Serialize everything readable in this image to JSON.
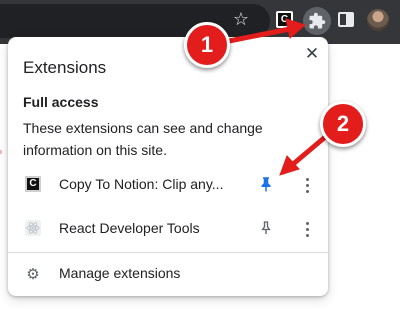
{
  "colors": {
    "toolbar_bg": "#35363a",
    "pin_active": "#1a73e8",
    "pin_inactive": "#5f6368",
    "marker_red": "#e31c1c"
  },
  "toolbar": {
    "icons": [
      "star-icon",
      "copy-to-notion-extension-icon",
      "puzzle-icon",
      "side-panel-icon",
      "profile-avatar"
    ]
  },
  "popup": {
    "title": "Extensions",
    "close_symbol": "✕",
    "section": {
      "heading": "Full access",
      "description": "These extensions can see and change information on this site."
    },
    "extensions": [
      {
        "name": "Copy To Notion: Clip any...",
        "icon_text": "C",
        "pinned": true
      },
      {
        "name": "React Developer Tools",
        "icon_text": "",
        "pinned": false
      }
    ],
    "manage_label": "Manage extensions"
  },
  "annotations": {
    "marker_1": "1",
    "marker_2": "2"
  }
}
